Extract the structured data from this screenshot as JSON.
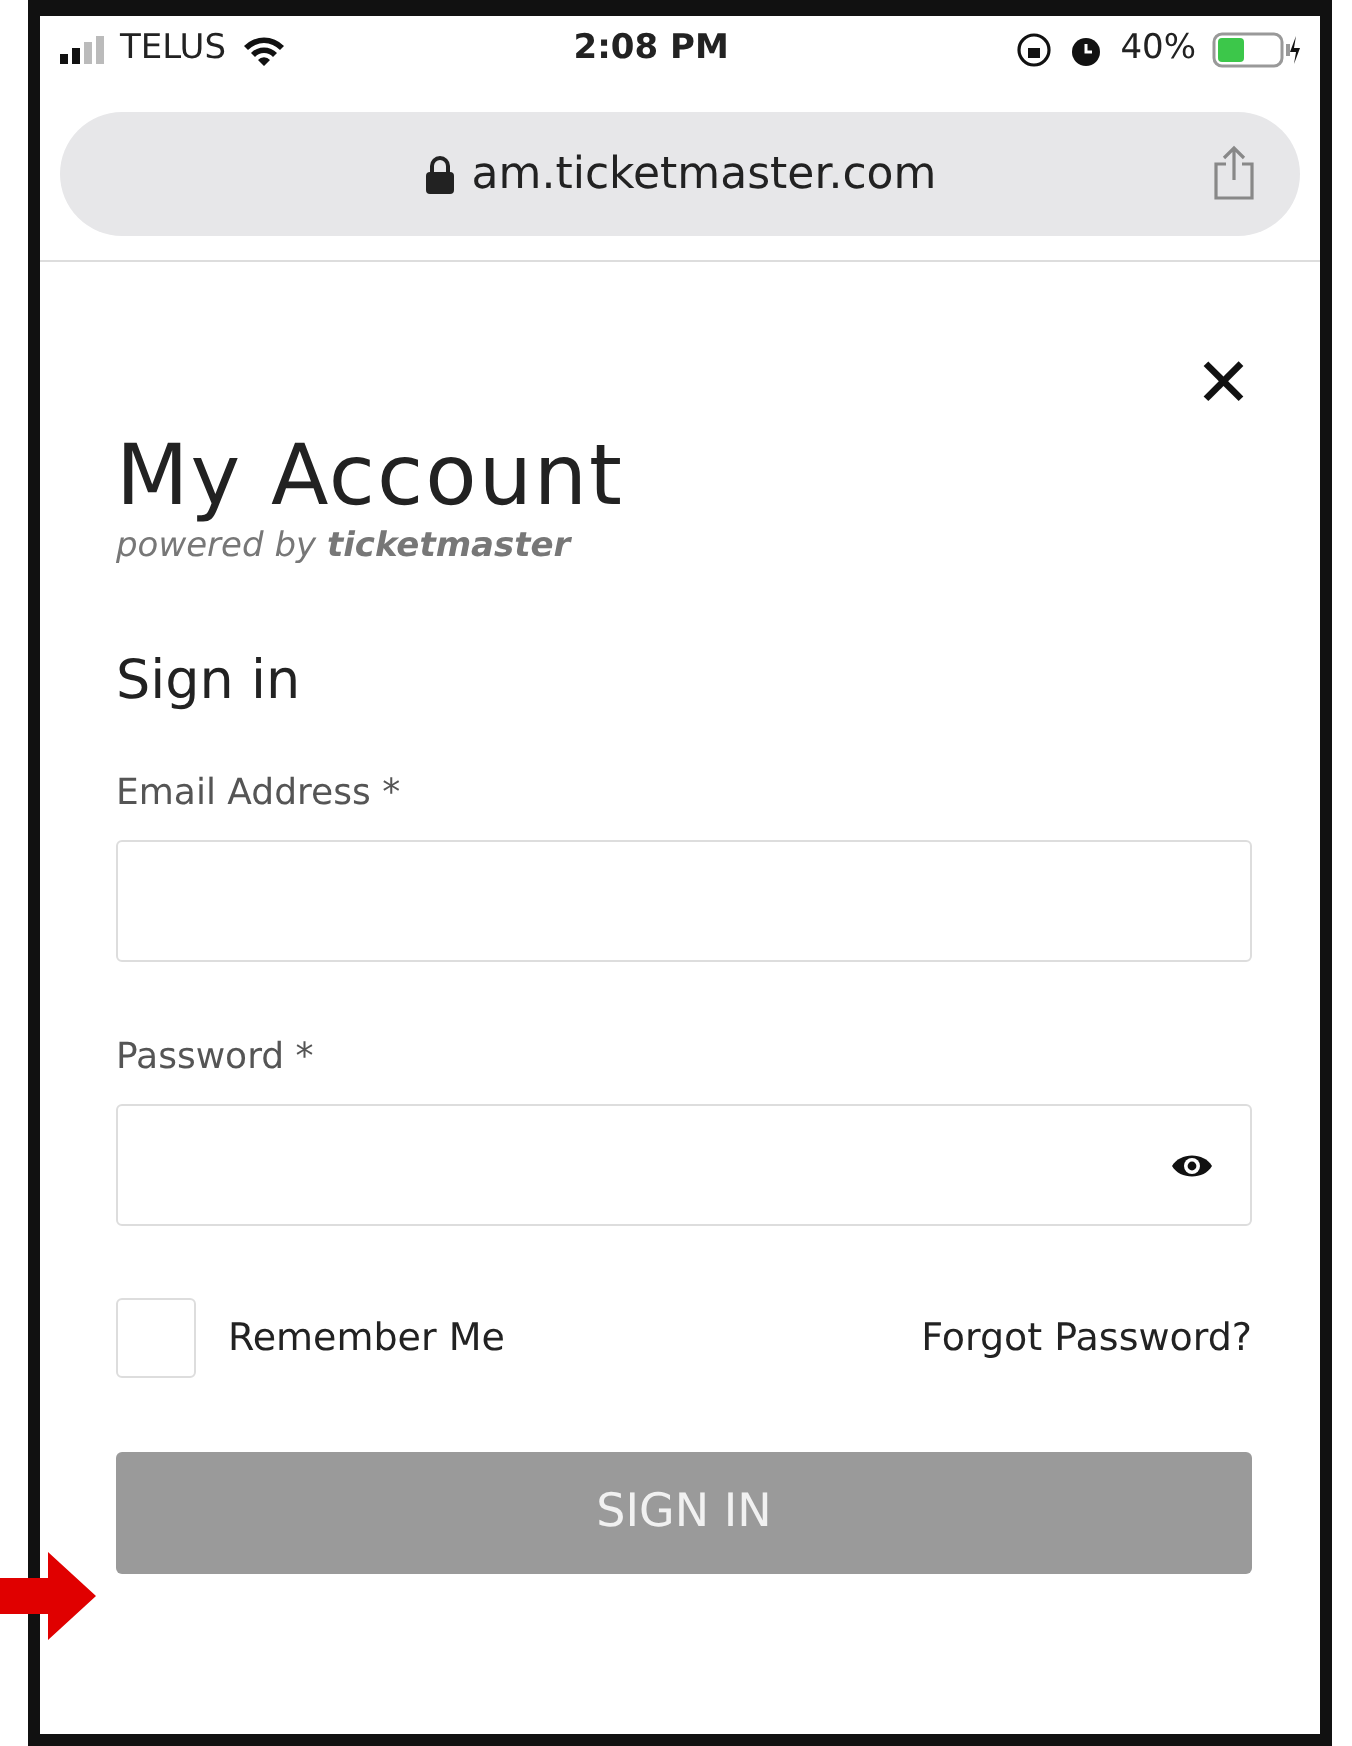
{
  "status_bar": {
    "carrier": "TELUS",
    "time": "2:08 PM",
    "battery": "40%"
  },
  "address_bar": {
    "url": "am.ticketmaster.com"
  },
  "page": {
    "close": "✕",
    "title": "My Account",
    "powered_by": "powered by **ticketmaster**",
    "heading": "Sign in",
    "fields": [
      {
        "label": "Email Address *",
        "kind": "email"
      },
      {
        "label": "Password *",
        "kind": "password"
      }
    ],
    "remember": {
      "label": "Remember Me",
      "checked": false
    },
    "forgot": "Forgot Password?",
    "submit": {
      "label": "SIGN IN",
      "disabled": true
    }
  }
}
